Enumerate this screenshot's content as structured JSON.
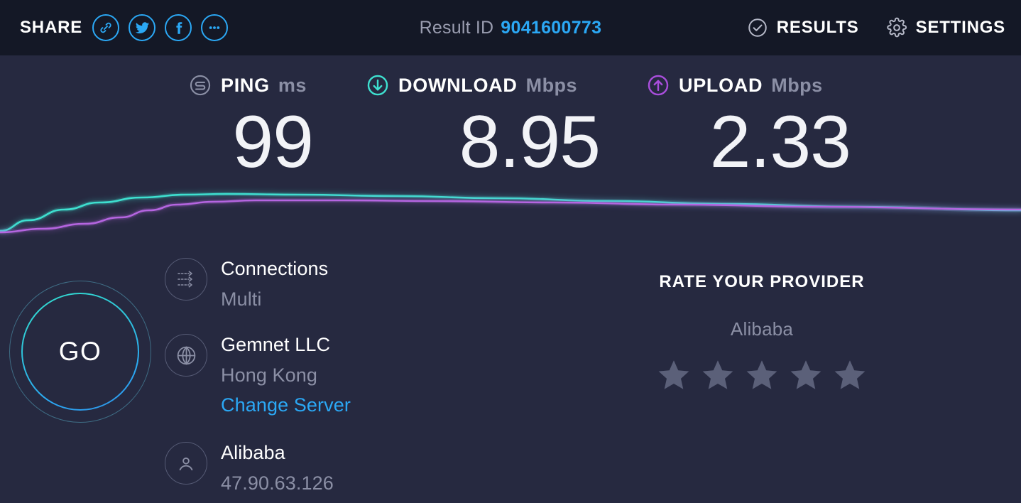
{
  "topbar": {
    "share_label": "SHARE",
    "share_buttons": [
      {
        "name": "link-icon",
        "title": "Copy link"
      },
      {
        "name": "twitter-icon",
        "title": "Share on Twitter"
      },
      {
        "name": "facebook-icon",
        "title": "Share on Facebook"
      },
      {
        "name": "more-icon",
        "title": "More sharing options"
      }
    ],
    "result_id_label": "Result ID",
    "result_id_value": "9041600773",
    "results_label": "RESULTS",
    "settings_label": "SETTINGS"
  },
  "metrics": {
    "ping": {
      "name": "PING",
      "unit": "ms",
      "value": "99",
      "color": "#8b8fa5"
    },
    "download": {
      "name": "DOWNLOAD",
      "unit": "Mbps",
      "value": "8.95",
      "color": "#3ee0d0"
    },
    "upload": {
      "name": "UPLOAD",
      "unit": "Mbps",
      "value": "2.33",
      "color": "#a94edc"
    }
  },
  "chart_data": {
    "type": "line",
    "title": "",
    "xlabel": "",
    "ylabel": "",
    "grid": false,
    "legend_position": "none",
    "series": [
      {
        "name": "Download",
        "color": "#3ee0d0",
        "points": [
          [
            0,
            325
          ],
          [
            40,
            310
          ],
          [
            90,
            295
          ],
          [
            140,
            285
          ],
          [
            200,
            278
          ],
          [
            260,
            274
          ],
          [
            320,
            273
          ],
          [
            420,
            274
          ],
          [
            560,
            276
          ],
          [
            700,
            279
          ],
          [
            860,
            283
          ],
          [
            1020,
            287
          ],
          [
            1200,
            291
          ],
          [
            1438,
            296
          ]
        ]
      },
      {
        "name": "Upload",
        "color": "#b565e0",
        "points": [
          [
            0,
            327
          ],
          [
            60,
            322
          ],
          [
            120,
            315
          ],
          [
            170,
            306
          ],
          [
            210,
            296
          ],
          [
            250,
            288
          ],
          [
            300,
            284
          ],
          [
            360,
            282
          ],
          [
            480,
            282
          ],
          [
            620,
            283
          ],
          [
            780,
            285
          ],
          [
            960,
            288
          ],
          [
            1150,
            291
          ],
          [
            1438,
            295
          ]
        ]
      }
    ]
  },
  "go_button": {
    "label": "GO"
  },
  "info": {
    "connections": {
      "icon": "connections-icon",
      "title": "Connections",
      "sub": "Multi"
    },
    "server": {
      "icon": "globe-icon",
      "title": "Gemnet LLC",
      "sub": "Hong Kong",
      "link": "Change Server"
    },
    "isp": {
      "icon": "person-icon",
      "title": "Alibaba",
      "sub": "47.90.63.126"
    }
  },
  "rate_provider": {
    "title": "RATE YOUR PROVIDER",
    "provider": "Alibaba",
    "star_count": 5,
    "rating": 0,
    "star_color": "#5b6079"
  },
  "colors": {
    "topbar_bg": "#141826",
    "main_bg": "#262940",
    "accent_blue": "#2ba8f5",
    "accent_cyan": "#3ee0d0",
    "accent_purple": "#a94edc",
    "muted_text": "#8b8fa5"
  }
}
